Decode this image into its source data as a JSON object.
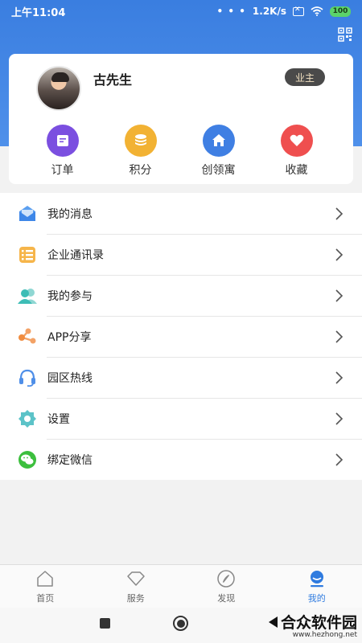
{
  "status_bar": {
    "time": "上午11:04",
    "dots": "• • •",
    "speed": "1.2K/s",
    "battery": "100"
  },
  "header": {
    "qr_icon": "qr-code-icon"
  },
  "profile": {
    "name": "古先生",
    "role": "业主"
  },
  "quick_actions": [
    {
      "label": "订单",
      "icon": "order-icon",
      "color": "#7b4fe0"
    },
    {
      "label": "积分",
      "icon": "points-coin-icon",
      "color": "#f2b233"
    },
    {
      "label": "创领寓",
      "icon": "home-icon",
      "color": "#3f7fe3"
    },
    {
      "label": "收藏",
      "icon": "heart-icon",
      "color": "#ef4f4f"
    }
  ],
  "menu": [
    {
      "label": "我的消息",
      "icon": "message-envelope-icon"
    },
    {
      "label": "企业通讯录",
      "icon": "contacts-book-icon"
    },
    {
      "label": "我的参与",
      "icon": "participants-icon"
    },
    {
      "label": "APP分享",
      "icon": "share-icon"
    },
    {
      "label": "园区热线",
      "icon": "headset-icon"
    },
    {
      "label": "设置",
      "icon": "settings-gear-icon"
    },
    {
      "label": "绑定微信",
      "icon": "wechat-icon"
    }
  ],
  "bottom_nav": [
    {
      "label": "首页",
      "icon": "home-outline-icon",
      "active": false
    },
    {
      "label": "服务",
      "icon": "diamond-outline-icon",
      "active": false
    },
    {
      "label": "发现",
      "icon": "compass-icon",
      "active": false
    },
    {
      "label": "我的",
      "icon": "profile-icon",
      "active": true
    }
  ],
  "watermark": {
    "text": "合众软件园",
    "url": "www.hezhong.net"
  },
  "colors": {
    "header_blue": "#3a7ee0",
    "accent": "#2f7bdf",
    "badge_bg": "#4a4a4a",
    "badge_text": "#f4e3c2"
  }
}
